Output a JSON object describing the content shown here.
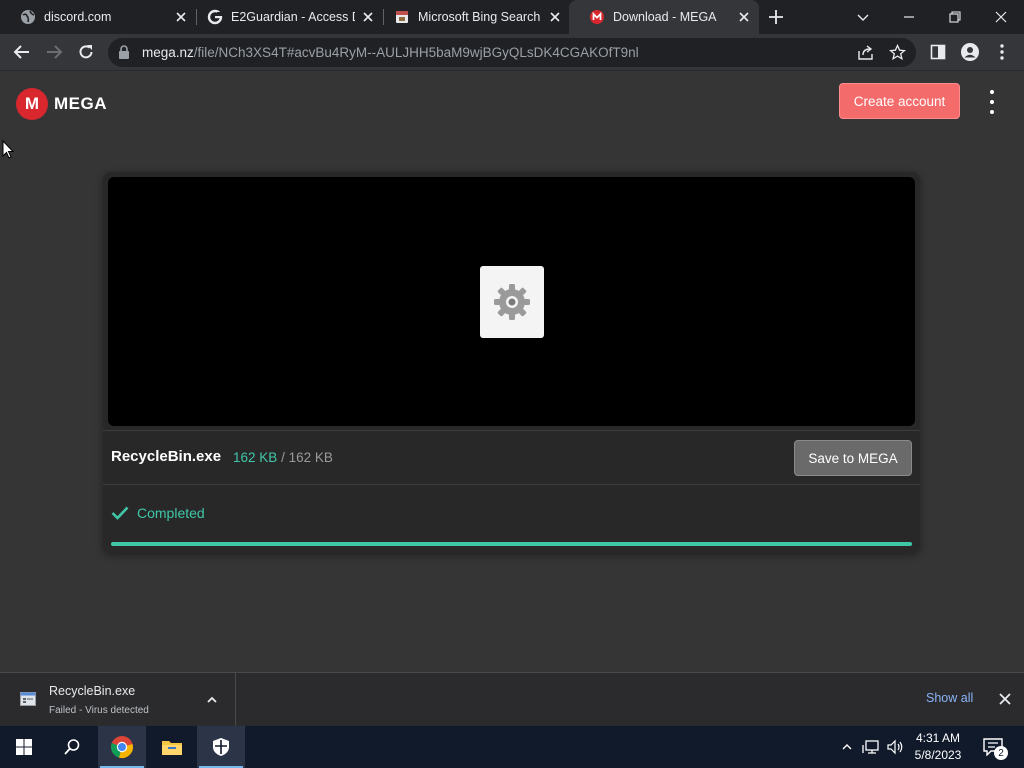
{
  "browser": {
    "tabs": [
      {
        "title": "discord.com",
        "favicon": "globe-icon"
      },
      {
        "title": "E2Guardian - Access De",
        "favicon": "google-icon"
      },
      {
        "title": "Microsoft Bing Search",
        "favicon": "bing-icon"
      },
      {
        "title": "Download - MEGA",
        "favicon": "mega-icon",
        "active": true
      }
    ],
    "address": {
      "host": "mega.nz",
      "path": "/file/NCh3XS4T#acvBu4RyM--AULJHH5baM9wjBGyQLsDK4CGAKOfT9nl"
    }
  },
  "mega": {
    "logo_letter": "M",
    "logo_text": "MEGA",
    "create_account_label": "Create account",
    "file": {
      "name": "RecycleBin.exe",
      "downloaded": "162 KB",
      "separator": "/",
      "total": "162 KB",
      "save_label": "Save to MEGA",
      "status": "Completed",
      "progress_percent": 100
    }
  },
  "download_shelf": {
    "item_name": "RecycleBin.exe",
    "item_status": "Failed - Virus detected",
    "show_all_label": "Show all"
  },
  "taskbar": {
    "time": "4:31 AM",
    "date": "5/8/2023",
    "notification_count": "2"
  },
  "colors": {
    "accent_teal": "#40c7a9",
    "mega_red": "#d9272e",
    "create_button": "#f46b6b",
    "link_blue": "#8ab4f8"
  }
}
